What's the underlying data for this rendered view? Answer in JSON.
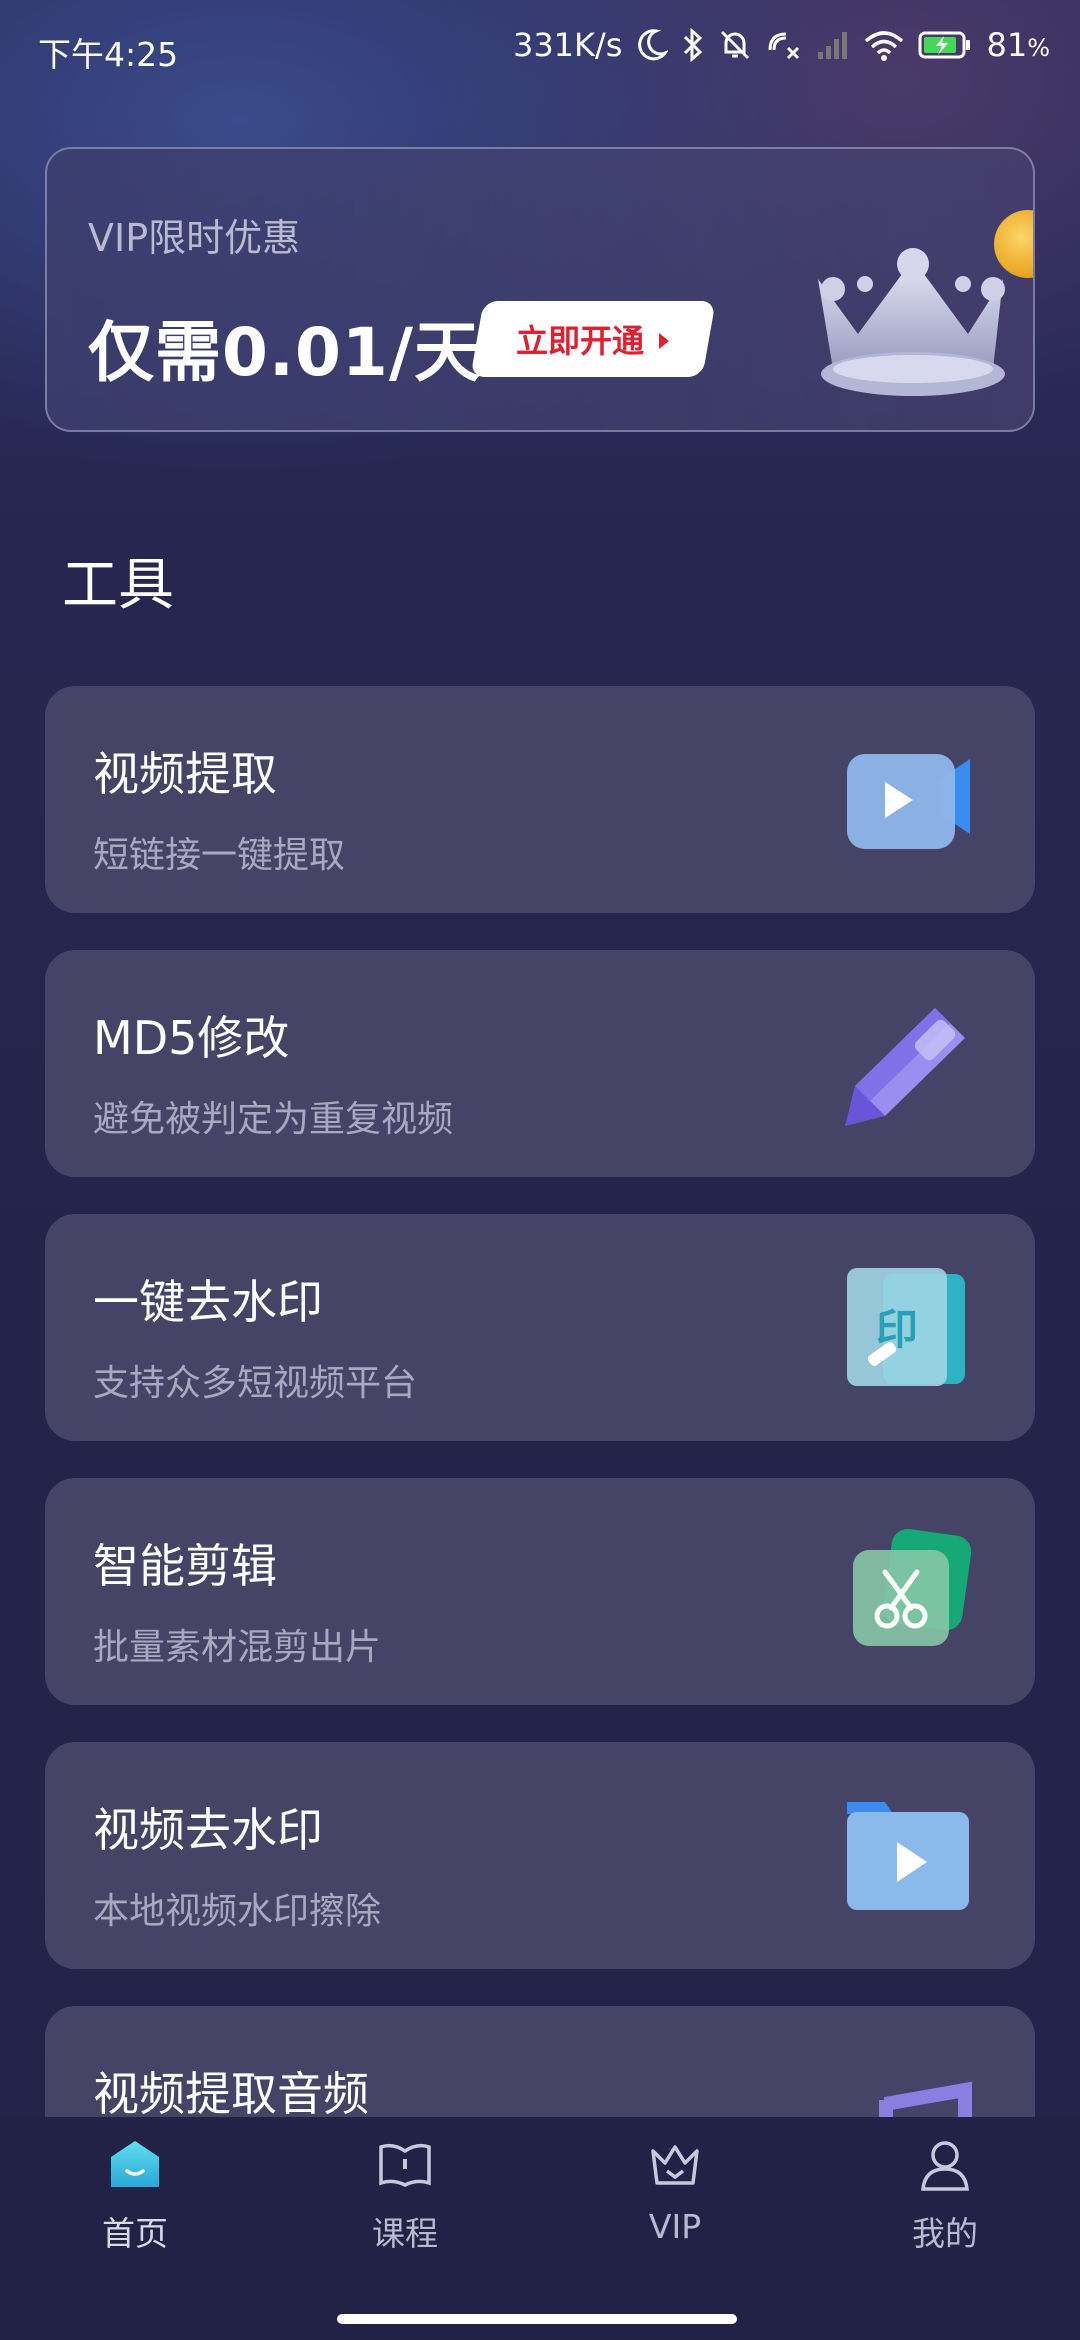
{
  "status_bar": {
    "time": "下午4:25",
    "network_speed": "331K/s",
    "battery": "81",
    "battery_unit": "%",
    "icons": [
      "moon-icon",
      "bluetooth-icon",
      "mute-bell-icon",
      "hd-call-icon",
      "signal-icon",
      "wifi-icon",
      "battery-icon"
    ]
  },
  "vip_banner": {
    "subtitle": "VIP限时优惠",
    "price": "仅需0.01/天",
    "button_label": "立即开通"
  },
  "tools": {
    "heading": "工具",
    "cards": [
      {
        "title": "视频提取",
        "desc": "短链接一键提取",
        "icon": "video-camera-icon"
      },
      {
        "title": "MD5修改",
        "desc": "避免被判定为重复视频",
        "icon": "pencil-icon"
      },
      {
        "title": "一键去水印",
        "desc": "支持众多短视频平台",
        "icon": "stamp-icon"
      },
      {
        "title": "智能剪辑",
        "desc": "批量素材混剪出片",
        "icon": "scissors-icon"
      },
      {
        "title": "视频去水印",
        "desc": "本地视频水印擦除",
        "icon": "video-folder-icon"
      },
      {
        "title": "视频提取音频",
        "desc": "",
        "icon": "music-note-icon"
      }
    ]
  },
  "bottom_nav": {
    "items": [
      {
        "label": "首页",
        "icon": "home-icon",
        "active": true
      },
      {
        "label": "课程",
        "icon": "book-icon",
        "active": false
      },
      {
        "label": "VIP",
        "icon": "crown-icon",
        "active": false
      },
      {
        "label": "我的",
        "icon": "user-icon",
        "active": false
      }
    ]
  },
  "colors": {
    "accent_red": "#e0202e",
    "card_bg": "#454466",
    "home_active": "#3cc6e6"
  }
}
